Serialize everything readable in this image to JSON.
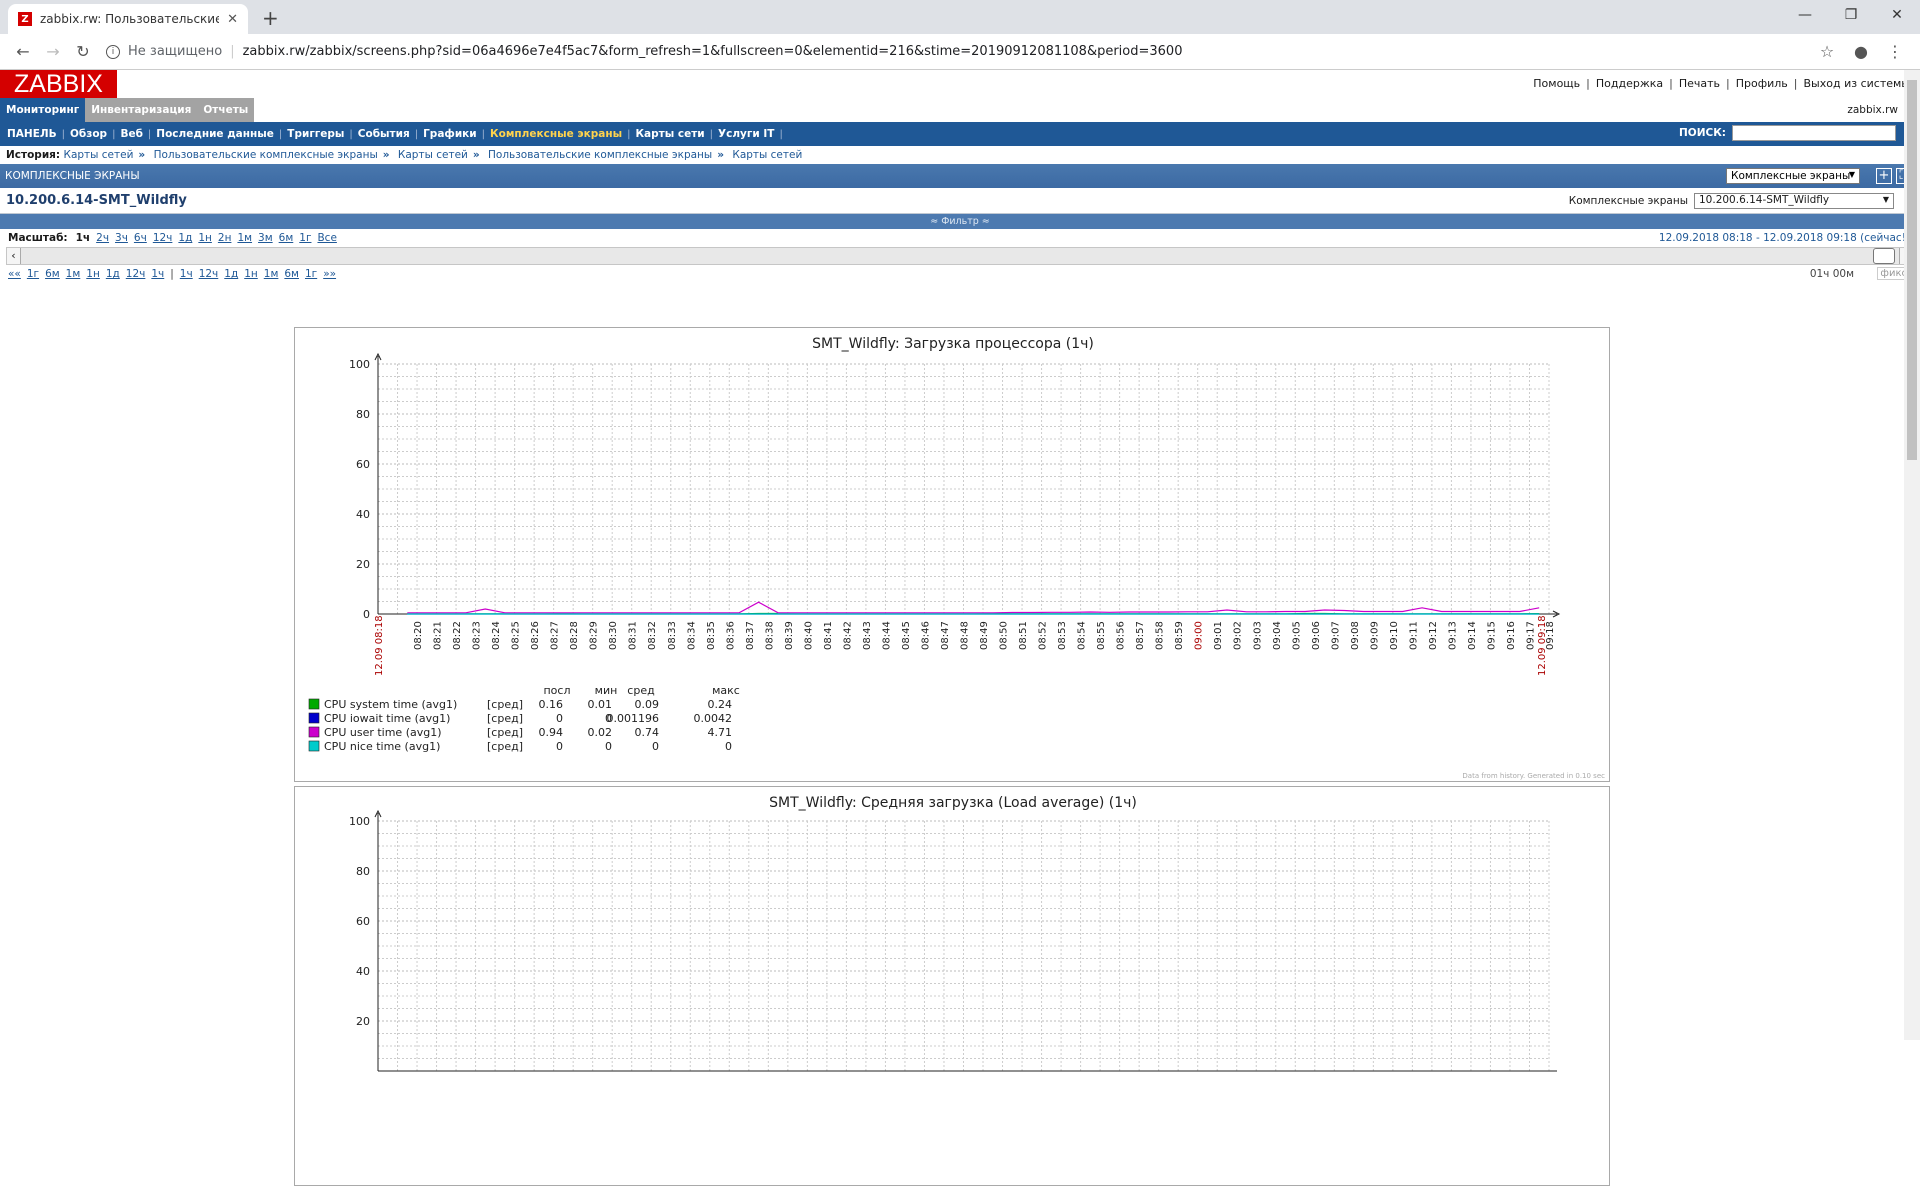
{
  "browser": {
    "tab_title": "zabbix.rw: Пользовательские ко",
    "url_insecure": "Не защищено",
    "url": "zabbix.rw/zabbix/screens.php?sid=06a4696e7e4f5ac7&form_refresh=1&fullscreen=0&elementid=216&stime=20190912081108&period=3600"
  },
  "header": {
    "logo": "ZABBIX",
    "links": [
      "Помощь",
      "Поддержка",
      "Печать",
      "Профиль",
      "Выход из системы"
    ],
    "server_name": "zabbix.rw"
  },
  "main_menu": [
    {
      "label": "Мониторинг",
      "active": true
    },
    {
      "label": "Инвентаризация",
      "active": false
    },
    {
      "label": "Отчеты",
      "active": false
    }
  ],
  "sub_menu": [
    {
      "label": "ПАНЕЛЬ",
      "selected": false
    },
    {
      "label": "Обзор",
      "selected": false
    },
    {
      "label": "Веб",
      "selected": false
    },
    {
      "label": "Последние данные",
      "selected": false
    },
    {
      "label": "Триггеры",
      "selected": false
    },
    {
      "label": "События",
      "selected": false
    },
    {
      "label": "Графики",
      "selected": false
    },
    {
      "label": "Комплексные экраны",
      "selected": true
    },
    {
      "label": "Карты сети",
      "selected": false
    },
    {
      "label": "Услуги IT",
      "selected": false
    }
  ],
  "search": {
    "label": "ПОИСК:",
    "value": ""
  },
  "history": {
    "label": "История:",
    "items": [
      "Карты сетей",
      "Пользовательские комплексные экраны",
      "Карты сетей",
      "Пользовательские комплексные экраны",
      "Карты сетей"
    ]
  },
  "section": {
    "title": "КОМПЛЕКСНЫЕ ЭКРАНЫ",
    "select_value": "Комплексные экраны"
  },
  "screen": {
    "title": "10.200.6.14-SMT_Wildfly",
    "selector_label": "Комплексные экраны",
    "selector_value": "10.200.6.14-SMT_Wildfly"
  },
  "filter_label": "≈ Фильтр ≈",
  "scale": {
    "label": "Масштаб:",
    "options": [
      "1ч",
      "2ч",
      "3ч",
      "6ч",
      "12ч",
      "1д",
      "1н",
      "2н",
      "1м",
      "3м",
      "6м",
      "1г",
      "Все"
    ],
    "current": "1ч",
    "range": "12.09.2018 08:18  -  12.09.2018 09:18 (сейчас!)",
    "nav_back": [
      "««",
      "1г",
      "6м",
      "1м",
      "1н",
      "1д",
      "12ч",
      "1ч"
    ],
    "nav_fwd": [
      "1ч",
      "12ч",
      "1д",
      "1н",
      "1м",
      "6м",
      "1г",
      "»»"
    ],
    "duration": "01ч 00м",
    "fixed": "фикс"
  },
  "chart_data": [
    {
      "type": "line",
      "title": "SMT_Wildfly: Загрузка процессора  (1ч)",
      "ylim": [
        0,
        100
      ],
      "yticks": [
        0,
        20,
        40,
        60,
        80,
        100
      ],
      "grid": true,
      "x_start_label": "12.09 08:18",
      "x_end_label": "12.09 09:18",
      "x_ticks": [
        "08:20",
        "08:21",
        "08:22",
        "08:23",
        "08:24",
        "08:25",
        "08:26",
        "08:27",
        "08:28",
        "08:29",
        "08:30",
        "08:31",
        "08:32",
        "08:33",
        "08:34",
        "08:35",
        "08:36",
        "08:37",
        "08:38",
        "08:39",
        "08:40",
        "08:41",
        "08:42",
        "08:43",
        "08:44",
        "08:45",
        "08:46",
        "08:47",
        "08:48",
        "08:49",
        "08:50",
        "08:51",
        "08:52",
        "08:53",
        "08:54",
        "08:55",
        "08:56",
        "08:57",
        "08:58",
        "08:59",
        "09:00",
        "09:01",
        "09:02",
        "09:03",
        "09:04",
        "09:05",
        "09:06",
        "09:07",
        "09:08",
        "09:09",
        "09:10",
        "09:11",
        "09:12",
        "09:13",
        "09:14",
        "09:15",
        "09:16",
        "09:17",
        "09:18"
      ],
      "legend_headers": [
        "посл",
        "мин",
        "сред",
        "макс"
      ],
      "series": [
        {
          "name": "CPU system time (avg1)",
          "func": "[сред]",
          "color": "#00aa00",
          "last": "0.16",
          "min": "0.01",
          "avg": "0.09",
          "max": "0.24",
          "values": [
            0.1,
            0.1,
            0.1,
            0.1,
            0.1,
            0.1,
            0.1,
            0.1,
            0.2,
            0.1,
            0.1,
            0.1,
            0.1,
            0.1,
            0.1,
            0.1,
            0.1,
            0.1,
            0.2,
            0.2,
            0.1,
            0.1,
            0.1,
            0.1,
            0.1,
            0.1,
            0.1,
            0.1,
            0.1,
            0.1,
            0.2,
            0.1,
            0.1,
            0.1,
            0.1,
            0.1,
            0.1,
            0.1,
            0.1,
            0.1,
            0.1,
            0.1,
            0.1,
            0.1,
            0.1,
            0.1,
            0.2,
            0.2,
            0.1,
            0.1,
            0.1,
            0.1,
            0.1,
            0.1,
            0.1,
            0.1,
            0.1,
            0.1,
            0.16
          ]
        },
        {
          "name": "CPU iowait time (avg1)",
          "func": "[сред]",
          "color": "#0000cc",
          "last": "0",
          "min": "0",
          "avg": "0.001196",
          "max": "0.0042",
          "values": [
            0,
            0,
            0,
            0,
            0,
            0,
            0,
            0,
            0,
            0,
            0,
            0,
            0,
            0,
            0,
            0,
            0,
            0,
            0,
            0,
            0,
            0,
            0,
            0,
            0,
            0,
            0,
            0,
            0,
            0,
            0,
            0,
            0,
            0,
            0,
            0,
            0,
            0,
            0,
            0,
            0,
            0,
            0,
            0,
            0,
            0,
            0,
            0,
            0,
            0,
            0,
            0,
            0,
            0,
            0,
            0,
            0,
            0,
            0
          ]
        },
        {
          "name": "CPU user time (avg1)",
          "func": "[сред]",
          "color": "#cc00cc",
          "last": "0.94",
          "min": "0.02",
          "avg": "0.74",
          "max": "4.71",
          "values": [
            0.5,
            0.5,
            0.5,
            0.5,
            2.0,
            0.5,
            0.5,
            0.5,
            0.5,
            0.5,
            0.5,
            0.5,
            0.5,
            0.5,
            0.5,
            0.5,
            0.5,
            0.5,
            4.71,
            0.5,
            0.5,
            0.5,
            0.5,
            0.5,
            0.5,
            0.5,
            0.5,
            0.5,
            0.5,
            0.5,
            0.5,
            0.6,
            0.6,
            0.7,
            0.7,
            0.8,
            0.7,
            0.8,
            0.8,
            0.8,
            0.9,
            0.9,
            1.6,
            0.9,
            0.9,
            1.0,
            1.0,
            1.6,
            1.4,
            1.0,
            1.0,
            1.0,
            2.5,
            1.0,
            1.0,
            1.0,
            1.0,
            1.0,
            2.5
          ]
        },
        {
          "name": "CPU nice time (avg1)",
          "func": "[сред]",
          "color": "#00cccc",
          "last": "0",
          "min": "0",
          "avg": "0",
          "max": "0",
          "values": [
            0,
            0,
            0,
            0,
            0,
            0,
            0,
            0,
            0,
            0,
            0,
            0,
            0,
            0,
            0,
            0,
            0,
            0,
            0,
            0,
            0,
            0,
            0,
            0,
            0,
            0,
            0,
            0,
            0,
            0,
            0,
            0,
            0,
            0,
            0,
            0,
            0,
            0,
            0,
            0,
            0,
            0,
            0,
            0,
            0,
            0,
            0,
            0,
            0,
            0,
            0,
            0,
            0,
            0,
            0,
            0,
            0,
            0,
            0
          ]
        }
      ],
      "footer": "Data from history. Generated in 0.10 sec"
    },
    {
      "type": "line",
      "title": "SMT_Wildfly: Средняя загрузка (Load average)  (1ч)",
      "ylim": [
        0,
        100
      ],
      "yticks": [
        20,
        40,
        60,
        80,
        100
      ],
      "grid": true
    }
  ]
}
